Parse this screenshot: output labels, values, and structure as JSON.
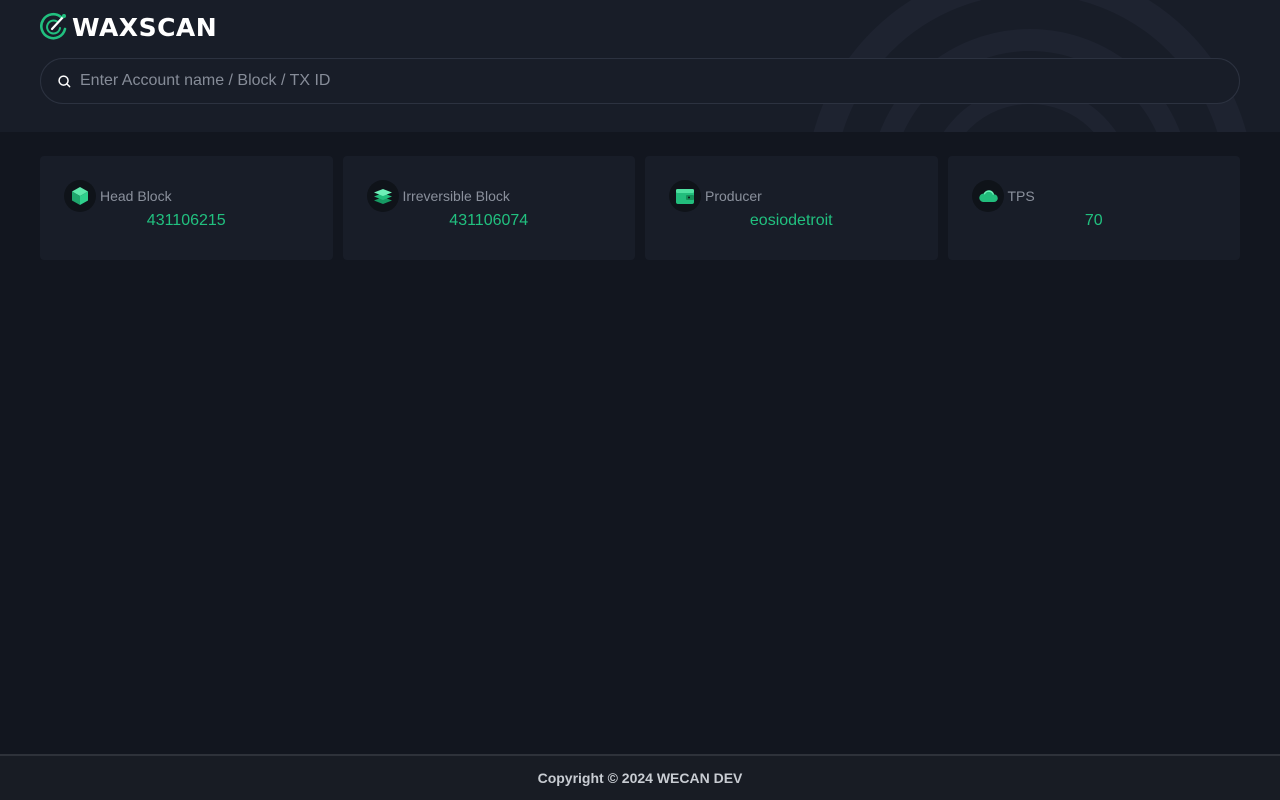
{
  "app": {
    "brand": "WAXSCAN"
  },
  "search": {
    "placeholder": "Enter Account name / Block / TX ID",
    "value": ""
  },
  "stats": [
    {
      "label": "Head Block",
      "value": "431106215",
      "icon": "cube-icon"
    },
    {
      "label": "Irreversible Block",
      "value": "431106074",
      "icon": "layers-icon"
    },
    {
      "label": "Producer",
      "value": "eosiodetroit",
      "icon": "wallet-icon"
    },
    {
      "label": "TPS",
      "value": "70",
      "icon": "cloud-icon"
    }
  ],
  "footer": {
    "copyright": "Copyright © 2024 WECAN DEV"
  },
  "colors": {
    "accent": "#21c07f",
    "background": "#12161f",
    "surface": "#181d28"
  }
}
